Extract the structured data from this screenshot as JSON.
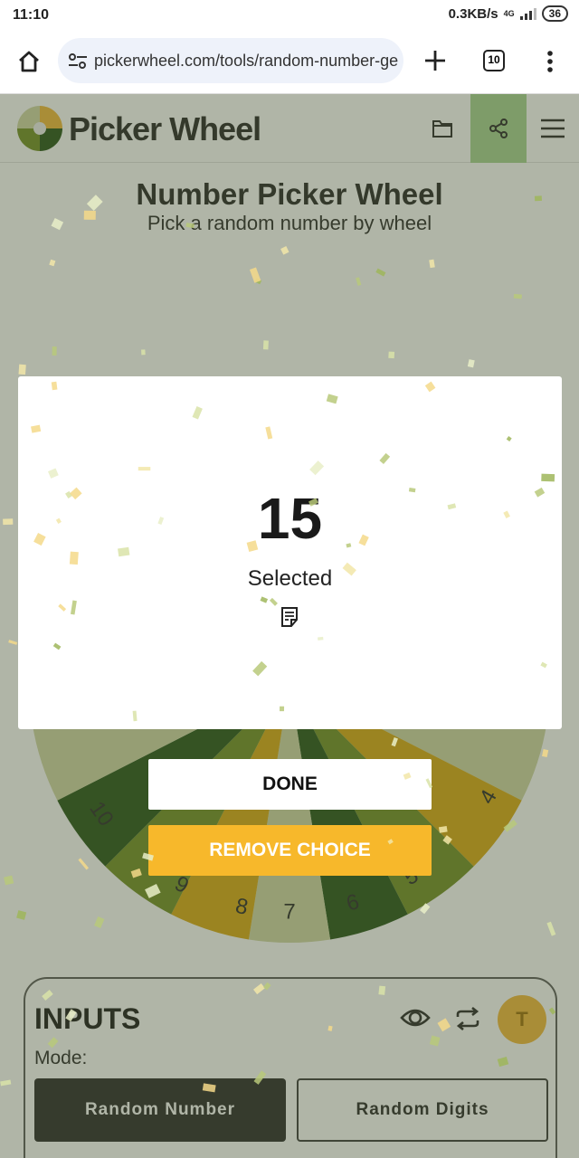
{
  "status_bar": {
    "time": "11:10",
    "speed": "0.3KB/s",
    "network": "4G",
    "battery": "36"
  },
  "browser": {
    "url": "pickerwheel.com/tools/random-number-ge",
    "tab_count": "10"
  },
  "site": {
    "brand": "Picker Wheel"
  },
  "page": {
    "title": "Number Picker Wheel",
    "subtitle": "Pick a random number by wheel"
  },
  "wheel": {
    "labels": [
      "10",
      "9",
      "8",
      "7",
      "6",
      "5",
      "4"
    ],
    "colors": {
      "dark": "#1f4e0f",
      "olive": "#6e8a1e",
      "light": "#cfd5a2",
      "gold": "#d9a60c"
    }
  },
  "result": {
    "number": "15",
    "label": "Selected"
  },
  "buttons": {
    "done": "DONE",
    "remove": "REMOVE CHOICE"
  },
  "inputs": {
    "title": "INPUTS",
    "mode_label": "Mode:",
    "modes": [
      {
        "label": "Random Number",
        "active": true
      },
      {
        "label": "Random Digits",
        "active": false
      }
    ],
    "avatar_letter": "T"
  }
}
